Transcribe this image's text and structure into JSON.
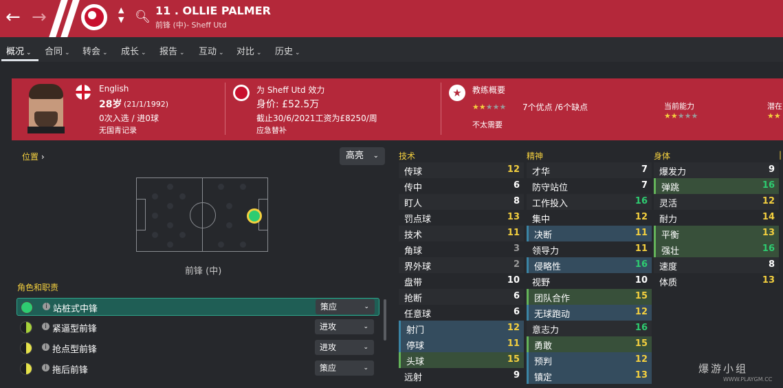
{
  "header": {
    "player_name": "11 . OLLIE PALMER",
    "subtitle": "前锋 (中)- Sheff Utd",
    "back_icon": "arrow-left-icon",
    "forward_icon": "arrow-right-icon",
    "search_icon": "search-icon",
    "accent": "#b4283a"
  },
  "tabs": [
    "概况",
    "合同",
    "转会",
    "成长",
    "报告",
    "互动",
    "对比",
    "历史"
  ],
  "card": {
    "nationality": "English",
    "age": "28岁",
    "dob": "(21/1/1992)",
    "caps": "0次入选 / 进0球",
    "youth": "无国青记录",
    "club_line": "为 Sheff Utd 效力",
    "value": "身价: £52.5万",
    "contract": "截止30/6/2021工资为£8250/周",
    "squad_status": "应急替补",
    "coach_title": "教练概要",
    "coach_stars": 2,
    "pros_cons": "7个优点 /6个缺点",
    "coach_note": "不太需要",
    "current_ability_label": "当前能力",
    "current_ability_stars": 2,
    "potential_label": "潜在",
    "potential_stars": 2
  },
  "position": {
    "link_label": "位置",
    "highlight_select": "高亮",
    "label": "前锋 (中)"
  },
  "roles": {
    "header": "角色和职责",
    "items": [
      {
        "name": "站桩式中锋",
        "duty": "策应",
        "color": "#2ecc71",
        "selected": true
      },
      {
        "name": "紧逼型前锋",
        "duty": "进攻",
        "color": "#a7d13a",
        "selected": false
      },
      {
        "name": "抢点型前锋",
        "duty": "进攻",
        "color": "#e5e24a",
        "selected": false
      },
      {
        "name": "拖后前锋",
        "duty": "策应",
        "color": "#e5e24a",
        "selected": false
      }
    ]
  },
  "attributes": {
    "technical": {
      "header": "技术",
      "items": [
        {
          "name": "传球",
          "value": "12",
          "color": "yel"
        },
        {
          "name": "传中",
          "value": "6",
          "color": "wht"
        },
        {
          "name": "盯人",
          "value": "8",
          "color": "wht"
        },
        {
          "name": "罚点球",
          "value": "13",
          "color": "yel"
        },
        {
          "name": "技术",
          "value": "11",
          "color": "yel"
        },
        {
          "name": "角球",
          "value": "3",
          "color": "gry"
        },
        {
          "name": "界外球",
          "value": "2",
          "color": "gry"
        },
        {
          "name": "盘带",
          "value": "10",
          "color": "wht"
        },
        {
          "name": "抢断",
          "value": "6",
          "color": "wht"
        },
        {
          "name": "任意球",
          "value": "6",
          "color": "wht"
        },
        {
          "name": "射门",
          "value": "12",
          "color": "yel",
          "hl": "blue"
        },
        {
          "name": "停球",
          "value": "11",
          "color": "yel",
          "hl": "blue"
        },
        {
          "name": "头球",
          "value": "15",
          "color": "yel",
          "hl": "green"
        },
        {
          "name": "远射",
          "value": "9",
          "color": "wht"
        }
      ]
    },
    "mental": {
      "header": "精神",
      "items": [
        {
          "name": "才华",
          "value": "7",
          "color": "wht"
        },
        {
          "name": "防守站位",
          "value": "7",
          "color": "wht"
        },
        {
          "name": "工作投入",
          "value": "16",
          "color": "grn"
        },
        {
          "name": "集中",
          "value": "12",
          "color": "yel"
        },
        {
          "name": "决断",
          "value": "11",
          "color": "yel",
          "hl": "blue"
        },
        {
          "name": "领导力",
          "value": "11",
          "color": "yel"
        },
        {
          "name": "侵略性",
          "value": "16",
          "color": "grn",
          "hl": "blue"
        },
        {
          "name": "视野",
          "value": "10",
          "color": "wht"
        },
        {
          "name": "团队合作",
          "value": "15",
          "color": "yel",
          "hl": "green"
        },
        {
          "name": "无球跑动",
          "value": "12",
          "color": "yel",
          "hl": "blue"
        },
        {
          "name": "意志力",
          "value": "16",
          "color": "grn"
        },
        {
          "name": "勇敢",
          "value": "15",
          "color": "yel",
          "hl": "green"
        },
        {
          "name": "预判",
          "value": "12",
          "color": "yel",
          "hl": "blue"
        },
        {
          "name": "镇定",
          "value": "13",
          "color": "yel",
          "hl": "blue"
        }
      ]
    },
    "physical": {
      "header": "身体",
      "items": [
        {
          "name": "爆发力",
          "value": "9",
          "color": "wht"
        },
        {
          "name": "弹跳",
          "value": "16",
          "color": "grn",
          "hl": "green"
        },
        {
          "name": "灵活",
          "value": "12",
          "color": "yel"
        },
        {
          "name": "耐力",
          "value": "14",
          "color": "yel"
        },
        {
          "name": "平衡",
          "value": "13",
          "color": "yel",
          "hl": "green"
        },
        {
          "name": "强壮",
          "value": "16",
          "color": "grn",
          "hl": "green"
        },
        {
          "name": "速度",
          "value": "8",
          "color": "wht"
        },
        {
          "name": "体质",
          "value": "13",
          "color": "yel"
        }
      ]
    }
  },
  "watermark": {
    "main": "爆游小组",
    "url": "WWW.PLAYGM.CC"
  }
}
